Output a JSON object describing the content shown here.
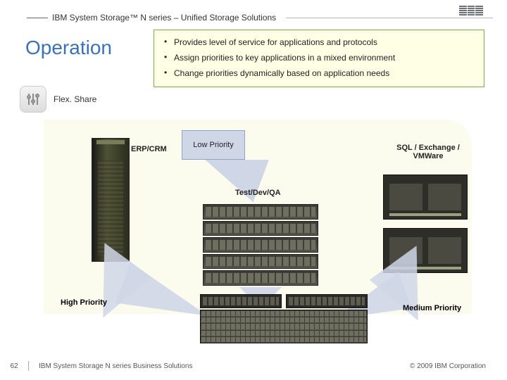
{
  "header": {
    "title": "IBM System Storage™ N series – Unified Storage Solutions",
    "logo_name": "ibm-logo"
  },
  "section_title": "Operation",
  "bullets": [
    "Provides level of service for applications and protocols",
    "Assign priorities to key applications in a mixed environment",
    "Change priorities dynamically based on application needs"
  ],
  "flexshare": {
    "label": "Flex. Share"
  },
  "diagram": {
    "erp_label": "ERP/CRM",
    "low_priority": "Low Priority",
    "testdev_label": "Test/Dev/QA",
    "sql_label": "SQL / Exchange / VMWare",
    "high_priority": "High Priority",
    "medium_priority": "Medium Priority"
  },
  "footer": {
    "page_number": "62",
    "title": "IBM System Storage N series Business Solutions",
    "copyright": "© 2009 IBM Corporation"
  },
  "colors": {
    "title_blue": "#3a72b5",
    "box_bg": "#feffe4",
    "box_border": "#7ea851",
    "arrow_fill": "#cfd6e6"
  }
}
